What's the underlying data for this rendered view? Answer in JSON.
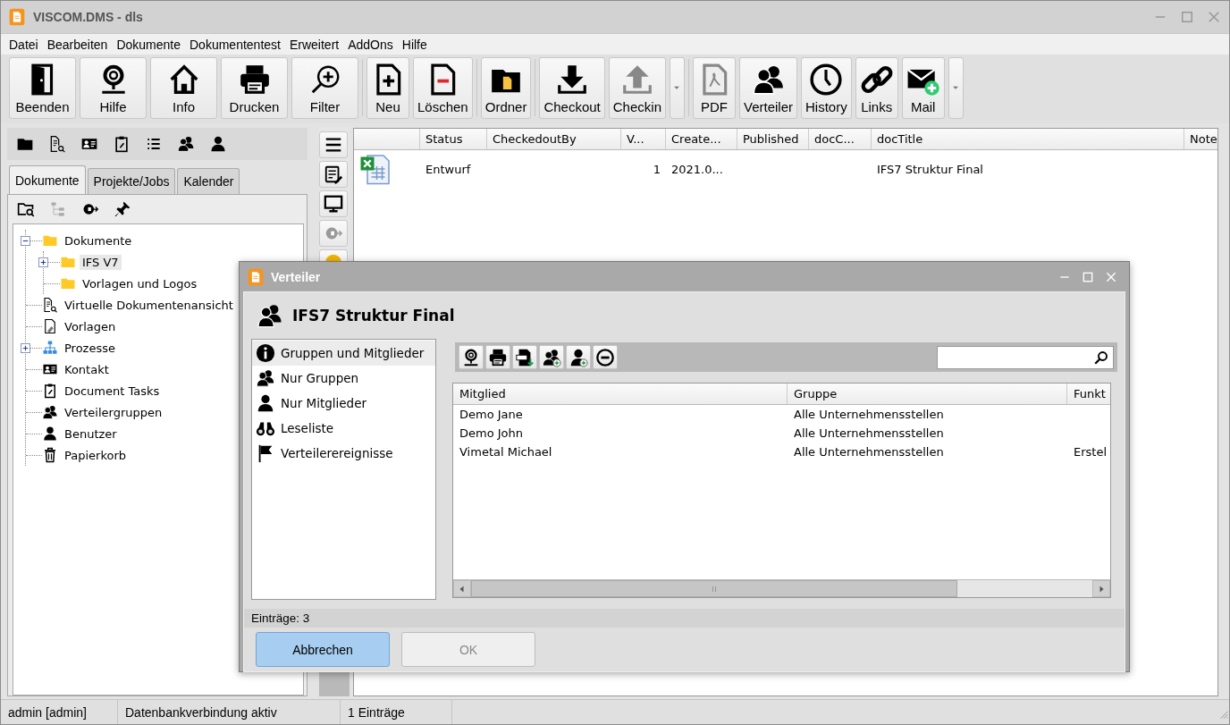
{
  "window": {
    "title": "VISCOM.DMS - dls"
  },
  "menu": [
    "Datei",
    "Bearbeiten",
    "Dokumente",
    "Dokumententest",
    "Erweitert",
    "AddOns",
    "Hilfe"
  ],
  "toolbar": {
    "groups": [
      {
        "items": [
          {
            "kind": "button",
            "label": "Beenden"
          },
          {
            "kind": "button",
            "label": "Hilfe"
          },
          {
            "kind": "button",
            "label": "Info"
          },
          {
            "kind": "button",
            "label": "Drucken"
          },
          {
            "kind": "button",
            "label": "Filter"
          }
        ]
      },
      {
        "items": [
          {
            "kind": "button",
            "label": "Neu"
          },
          {
            "kind": "button",
            "label": "Löschen"
          }
        ]
      },
      {
        "items": [
          {
            "kind": "button",
            "label": "Ordner"
          }
        ]
      },
      {
        "items": [
          {
            "kind": "button",
            "label": "Checkout"
          },
          {
            "kind": "button",
            "label": "Checkin"
          },
          {
            "kind": "dropdown"
          }
        ]
      },
      {
        "items": [
          {
            "kind": "button",
            "label": "PDF"
          },
          {
            "kind": "button",
            "label": "Verteiler"
          },
          {
            "kind": "button",
            "label": "History"
          },
          {
            "kind": "button",
            "label": "Links"
          },
          {
            "kind": "button",
            "label": "Mail"
          },
          {
            "kind": "dropdown"
          }
        ]
      }
    ]
  },
  "sidebar": {
    "tabs": [
      {
        "label": "Dokumente",
        "selected": true
      },
      {
        "label": "Projekte/Jobs",
        "selected": false
      },
      {
        "label": "Kalender",
        "selected": false
      }
    ],
    "tree": [
      {
        "label": "Dokumente",
        "expanded": true,
        "selected": false,
        "children": [
          {
            "label": "IFS V7",
            "expanded": false,
            "selected": true
          },
          {
            "label": "Vorlagen und Logos",
            "selected": false
          }
        ]
      },
      {
        "label": "Virtuelle Dokumentenansicht",
        "selected": false
      },
      {
        "label": "Vorlagen",
        "selected": false
      },
      {
        "label": "Prozesse",
        "expanded": false,
        "selected": false
      },
      {
        "label": "Kontakt",
        "selected": false
      },
      {
        "label": "Document Tasks",
        "selected": false
      },
      {
        "label": "Verteilergruppen",
        "selected": false
      },
      {
        "label": "Benutzer",
        "selected": false
      },
      {
        "label": "Papierkorb",
        "selected": false
      }
    ]
  },
  "documents": {
    "columns": [
      "Status",
      "CheckedoutBy",
      "V...",
      "Create...",
      "Published",
      "docC...",
      "docTitle",
      "Note"
    ],
    "rows": [
      {
        "cells": [
          "Entwurf",
          null,
          "1",
          "2021.0...",
          null,
          null,
          "IFS7 Struktur Final",
          null
        ]
      }
    ]
  },
  "status_bar": [
    "admin [admin]",
    "Datenbankverbindung aktiv",
    "1 Einträge"
  ],
  "dialog": {
    "title": "Verteiler",
    "heading": "IFS7 Struktur Final",
    "views": [
      {
        "label": "Gruppen und Mitglieder",
        "selected": true
      },
      {
        "label": "Nur Gruppen",
        "selected": false
      },
      {
        "label": "Nur Mitglieder",
        "selected": false
      },
      {
        "label": "Leseliste",
        "selected": false
      },
      {
        "label": "Verteilerereignisse",
        "selected": false
      }
    ],
    "members": {
      "columns": [
        "Mitglied",
        "Gruppe",
        "Funkt"
      ],
      "rows": [
        {
          "cells": [
            "Demo Jane",
            "Alle Unternehmensstellen",
            null
          ]
        },
        {
          "cells": [
            "Demo John",
            "Alle Unternehmensstellen",
            null
          ]
        },
        {
          "cells": [
            "Vimetal Michael",
            "Alle Unternehmensstellen",
            "Erstel"
          ]
        }
      ]
    },
    "count": "Einträge: 3",
    "buttons": [
      {
        "label": "Abbrechen",
        "default": true,
        "disabled": false
      },
      {
        "label": "OK",
        "default": false,
        "disabled": true
      }
    ]
  }
}
